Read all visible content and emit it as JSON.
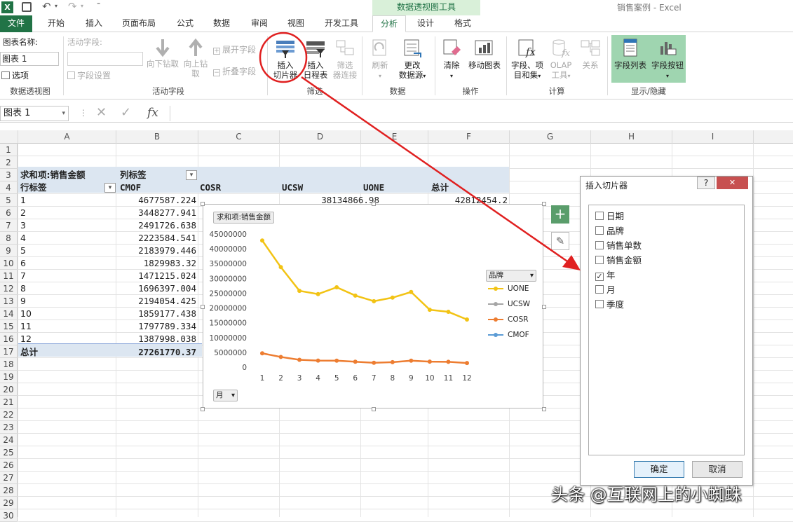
{
  "title_bar": {
    "contextual_tools": "数据透视图工具",
    "app_title": "销售案例 - Excel"
  },
  "tabs": [
    "文件",
    "开始",
    "插入",
    "页面布局",
    "公式",
    "数据",
    "审阅",
    "视图",
    "开发工具",
    "分析",
    "设计",
    "格式"
  ],
  "ribbon": {
    "chart_name_label": "图表名称:",
    "chart_name_value": "图表 1",
    "options": "选项",
    "active_field_label": "活动字段:",
    "field_settings": "字段设置",
    "drill_down": "向下钻取",
    "drill_up": [
      "向上钻",
      "取"
    ],
    "expand_field": "展开字段",
    "collapse_field": "折叠字段",
    "insert_slicer": [
      "插入",
      "切片器"
    ],
    "insert_timeline": [
      "插入",
      "日程表"
    ],
    "filter_connections": [
      "筛选",
      "器连接"
    ],
    "refresh": "刷新",
    "change_source": [
      "更改",
      "数据源"
    ],
    "clear": "清除",
    "move_chart": "移动图表",
    "fields_items": [
      "字段、项",
      "目和集"
    ],
    "olap_tools": [
      "OLAP",
      "工具"
    ],
    "relationships": "关系",
    "field_list": "字段列表",
    "field_buttons": "字段按钮",
    "groups": [
      "数据透视图",
      "活动字段",
      "筛选",
      "数据",
      "操作",
      "计算",
      "显示/隐藏"
    ]
  },
  "formula_bar": {
    "name_box": "图表 1",
    "fx": "fx"
  },
  "columns": [
    "A",
    "B",
    "C",
    "D",
    "E",
    "F",
    "G",
    "H",
    "I"
  ],
  "rows": [
    "1",
    "2",
    "3",
    "4",
    "5",
    "6",
    "7",
    "8",
    "9",
    "10",
    "11",
    "12",
    "13",
    "14",
    "15",
    "16",
    "17",
    "18",
    "19",
    "20",
    "21",
    "22",
    "23",
    "24",
    "25",
    "26",
    "27",
    "28",
    "29",
    "30"
  ],
  "pivot": {
    "value_header": "求和项:销售金额",
    "col_label": "列标签",
    "row_label": "行标签",
    "col_headers": [
      "CMOF",
      "COSR",
      "UCSW",
      "UONE",
      "总计"
    ],
    "row5_ucsw": "38134866.98",
    "row5_total": "42812454.2",
    "month_rows": [
      "1",
      "2",
      "3",
      "4",
      "5",
      "6",
      "7",
      "8",
      "9",
      "10",
      "11",
      "12"
    ],
    "cmof_values": [
      "4677587.224",
      "3448277.941",
      "2491726.638",
      "2223584.541",
      "2183979.446",
      "1829983.32",
      "1471215.024",
      "1696397.004",
      "2194054.425",
      "1859177.438",
      "1797789.334",
      "1387998.038"
    ],
    "total_label": "总计",
    "total_value": "27261770.37"
  },
  "chart_data": {
    "type": "line",
    "title_button": "求和项:销售金额",
    "legend_title": "品牌",
    "legend_position": "right",
    "axis_button": "月",
    "categories": [
      "1",
      "2",
      "3",
      "4",
      "5",
      "6",
      "7",
      "8",
      "9",
      "10",
      "11",
      "12"
    ],
    "ylim": [
      0,
      45000000
    ],
    "yticks": [
      "0",
      "5000000",
      "10000000",
      "15000000",
      "20000000",
      "25000000",
      "30000000",
      "35000000",
      "40000000",
      "45000000"
    ],
    "series": [
      {
        "name": "UONE",
        "color": "#f2c314",
        "values": [
          42812454,
          33800000,
          25800000,
          24700000,
          27000000,
          24200000,
          22300000,
          23500000,
          25400000,
          19400000,
          18700000,
          16100000
        ]
      },
      {
        "name": "UCSW",
        "color": "#a5a5a5",
        "values": [
          null,
          null,
          null,
          null,
          null,
          null,
          null,
          null,
          null,
          null,
          null,
          null
        ]
      },
      {
        "name": "COSR",
        "color": "#ed7d31",
        "values": [
          4677587,
          3448278,
          2491727,
          2223585,
          2183979,
          1829983,
          1471215,
          1696397,
          2194054,
          1859177,
          1797789,
          1387998
        ]
      },
      {
        "name": "CMOF",
        "color": "#5b9bd5",
        "values": [
          null,
          null,
          null,
          null,
          null,
          null,
          null,
          null,
          null,
          null,
          null,
          null
        ]
      }
    ]
  },
  "dialog": {
    "title": "插入切片器",
    "help": "?",
    "close": "✕",
    "items": [
      {
        "label": "日期",
        "checked": false
      },
      {
        "label": "品牌",
        "checked": false
      },
      {
        "label": "销售单数",
        "checked": false
      },
      {
        "label": "销售金额",
        "checked": false
      },
      {
        "label": "年",
        "checked": true
      },
      {
        "label": "月",
        "checked": false
      },
      {
        "label": "季度",
        "checked": false
      }
    ],
    "ok": "确定",
    "cancel": "取消"
  },
  "watermark": "头条 @互联网上的小蜘蛛",
  "colors": {
    "excel_green": "#217346",
    "pivot_header": "#dce6f1",
    "annotation_red": "#e02020"
  }
}
